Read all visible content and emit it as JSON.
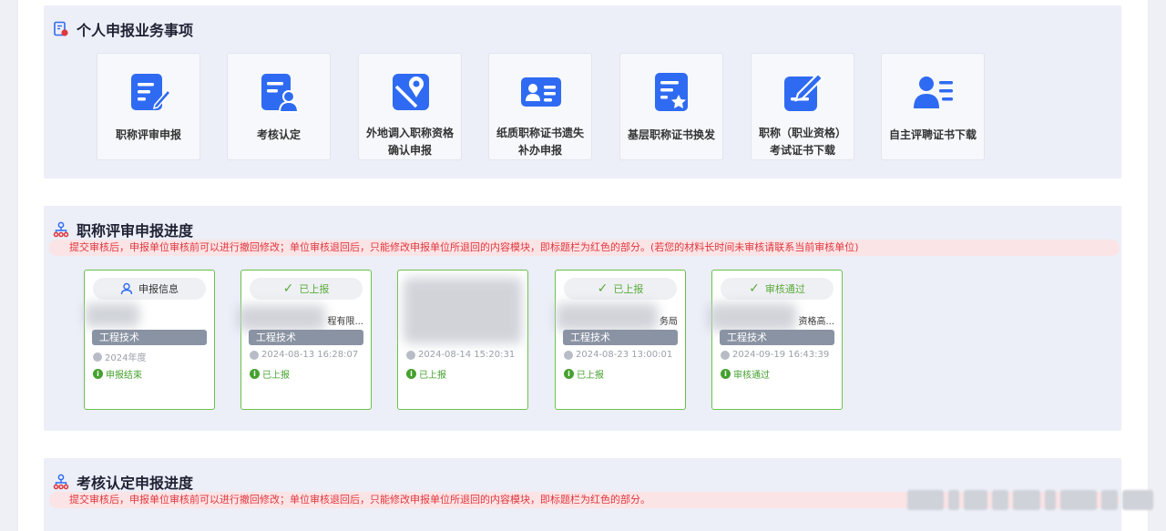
{
  "services": {
    "title": "个人申报业务事项",
    "tiles": [
      {
        "label": "职称评审申报",
        "icon": "edit-document-icon"
      },
      {
        "label": "考核认定",
        "icon": "user-document-icon"
      },
      {
        "label": "外地调入职称资格确认申报",
        "icon": "map-location-icon"
      },
      {
        "label": "纸质职称证书遗失补办申报",
        "icon": "id-card-icon"
      },
      {
        "label": "基层职称证书换发",
        "icon": "star-document-icon"
      },
      {
        "label": "职称（职业资格）考试证书下载",
        "icon": "pen-document-icon"
      },
      {
        "label": "自主评聘证书下载",
        "icon": "user-list-icon"
      }
    ]
  },
  "review_progress": {
    "title": "职称评审申报进度",
    "notice": "提交审核后，申报单位审核前可以进行撤回修改；单位审核退回后，只能修改申报单位所退回的内容模块，即标题栏为红色的部分。(若您的材料长时间未审核请联系当前审核单位)",
    "cards": [
      {
        "pill": "申报信息",
        "org": "",
        "tag": "工程技术",
        "time": "2024年度",
        "status": "申报结束"
      },
      {
        "pill": "已上报",
        "org": "程有限...",
        "tag": "工程技术",
        "time": "2024-08-13 16:28:07",
        "status": "已上报"
      },
      {
        "pill": "",
        "org": "",
        "tag": "",
        "time": "2024-08-14 15:20:31",
        "status": "已上报"
      },
      {
        "pill": "已上报",
        "org": "务局",
        "tag": "工程技术",
        "time": "2024-08-23 13:00:01",
        "status": "已上报"
      },
      {
        "pill": "审核通过",
        "org": "资格高...",
        "tag": "工程技术",
        "time": "2024-09-19 16:43:39",
        "status": "审核通过"
      }
    ]
  },
  "assess_progress": {
    "title": "考核认定申报进度",
    "notice": "提交审核后，申报单位审核前可以进行撤回修改；单位审核退回后，只能修改申报单位所退回的内容模块，即标题栏为红色的部分。"
  },
  "colors": {
    "accent": "#2f6bf2",
    "success": "#45a12e",
    "warning": "#e0373e"
  }
}
